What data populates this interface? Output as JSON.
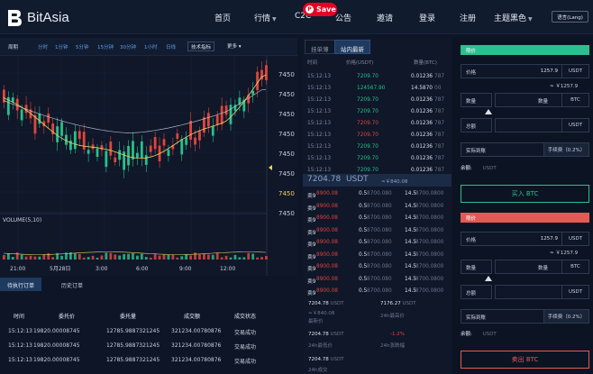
{
  "header": {
    "brand": "BitAsia",
    "nav": [
      "首页",
      "行情",
      "C2C",
      "公告",
      "邀请",
      "登录",
      "注册",
      "主题黑色"
    ],
    "save_label": "Save",
    "lang_label": "语言(Lang)"
  },
  "toolbar": {
    "items": [
      "周期",
      "分时",
      "1分钟",
      "5分钟",
      "15分钟",
      "30分钟",
      "1小时",
      "日线"
    ],
    "indicator_btn": "技术指标",
    "more_btn": "更多"
  },
  "chart": {
    "price_ticks": [
      "7450",
      "7450",
      "7450",
      "7450",
      "7450",
      "7450",
      "7450",
      "7450"
    ],
    "highlight_tick_index": 6,
    "volume_label": "VOLUME(5,10)",
    "time_labels": [
      "21:00",
      "5月28日",
      "3:00",
      "6:00",
      "9:00",
      "12:00"
    ],
    "colors": {
      "up": "#27c08b",
      "down": "#e0463c",
      "ma1": "#e6d36a",
      "ma2": "#cfd6e4"
    }
  },
  "orderbook": {
    "tabs": [
      "挂单薄",
      "站内最新"
    ],
    "active_tab": 1,
    "headers": [
      "时间",
      "价格(USDT)",
      "数量(BTC)"
    ],
    "trades": [
      {
        "time": "15:12:13",
        "price": "7209.70",
        "qty": "0.01236",
        "suffix": "787",
        "side": "buy"
      },
      {
        "time": "15:12:13",
        "price": "124567.90",
        "qty": "14.5870",
        "suffix": "00",
        "side": "buy"
      },
      {
        "time": "15:12:13",
        "price": "7209.70",
        "qty": "0.01236",
        "suffix": "787",
        "side": "buy"
      },
      {
        "time": "15:12:13",
        "price": "7209.70",
        "qty": "0.01236",
        "suffix": "787",
        "side": "buy"
      },
      {
        "time": "15:12:13",
        "price": "7209.70",
        "qty": "0.01236",
        "suffix": "787",
        "side": "sell"
      },
      {
        "time": "15:12:13",
        "price": "7209.70",
        "qty": "0.01236",
        "suffix": "787",
        "side": "sell"
      },
      {
        "time": "15:12:13",
        "price": "7209.70",
        "qty": "0.01236",
        "suffix": "787",
        "side": "buy"
      },
      {
        "time": "15:12:13",
        "price": "7209.70",
        "qty": "0.01236",
        "suffix": "787",
        "side": "buy"
      },
      {
        "time": "15:12:13",
        "price": "7209.70",
        "qty": "0.01236",
        "suffix": "787",
        "side": "buy"
      }
    ],
    "mid_price": "7204.78",
    "mid_unit": "USDT",
    "mid_cny": "≈￥840.08",
    "sell_rows": [
      {
        "label": "卖9",
        "price": "8900.08",
        "qty": "0.5",
        "qty_suffix": "8700.080",
        "total": "14.5",
        "total_suffix": "8700.0800"
      },
      {
        "label": "卖9",
        "price": "8900.08",
        "qty": "0.5",
        "qty_suffix": "8700.080",
        "total": "14.5",
        "total_suffix": "8700.0800"
      },
      {
        "label": "卖9",
        "price": "8900.08",
        "qty": "0.5",
        "qty_suffix": "8700.080",
        "total": "14.5",
        "total_suffix": "8700.0800"
      },
      {
        "label": "卖9",
        "price": "8900.08",
        "qty": "0.5",
        "qty_suffix": "8700.080",
        "total": "14.5",
        "total_suffix": "8700.0800"
      },
      {
        "label": "卖9",
        "price": "8900.08",
        "qty": "0.5",
        "qty_suffix": "8700.080",
        "total": "14.5",
        "total_suffix": "8700.0800"
      },
      {
        "label": "卖9",
        "price": "8900.08",
        "qty": "0.5",
        "qty_suffix": "8700.080",
        "total": "14.5",
        "total_suffix": "8700.0800"
      },
      {
        "label": "卖9",
        "price": "8900.08",
        "qty": "0.5",
        "qty_suffix": "8700.080",
        "total": "14.5",
        "total_suffix": "8700.0800"
      },
      {
        "label": "卖9",
        "price": "8900.08",
        "qty": "0.5",
        "qty_suffix": "8700.080",
        "total": "14.5",
        "total_suffix": "8700.0800"
      },
      {
        "label": "卖9",
        "price": "8900.08",
        "qty": "0.5",
        "qty_suffix": "8700.080",
        "total": "14.5",
        "total_suffix": "8700.0800"
      }
    ],
    "stats": {
      "last_price": "7204.78",
      "last_unit": "USDT",
      "last_cny": "≈￥840.08",
      "last_label": "最新价",
      "high_24": "7176.27",
      "high_unit": "USDT",
      "high_label": "24h最高价",
      "low_24": "7204.78",
      "low_unit": "USDT",
      "low_label": "24h最低价",
      "change_24": "-1.2%",
      "change_label": "24h涨跌幅",
      "vol_24": "7204.78",
      "vol_unit": "USDT",
      "vol_label": "24h成交"
    }
  },
  "buy_form": {
    "tag": "限价",
    "price_label": "价格",
    "price_value": "1257.9",
    "price_unit": "USDT",
    "approx": "≈ ￥1257.9",
    "qty_label": "数量",
    "qty_placeholder": "数量",
    "qty_unit": "BTC",
    "total_label": "总额",
    "total_unit": "USDT",
    "fee_prefix": "实际到账",
    "fee": "手续费（0.2%）",
    "balance_label": "余额:",
    "balance_unit": "USDT",
    "button": "买入 BTC"
  },
  "sell_form": {
    "tag": "限价",
    "price_label": "价格",
    "price_value": "1257.9",
    "price_unit": "USDT",
    "approx": "≈ ￥1257.9",
    "qty_label": "数量",
    "qty_placeholder": "数量",
    "qty_unit": "BTC",
    "total_label": "总额",
    "total_unit": "USDT",
    "fee_prefix": "实际到账",
    "fee": "手续费（0.2%）",
    "balance_label": "余额:",
    "balance_unit": "USDT",
    "button": "卖出 BTC"
  },
  "orders": {
    "tabs": [
      "待执行订单",
      "历史订单"
    ],
    "headers": [
      "时间",
      "委托价",
      "委托量",
      "成交额",
      "成交状态"
    ],
    "rows": [
      [
        "15:12:13",
        "19820.00008745",
        "12785.9887321245",
        "321234.00780876",
        "交易成功"
      ],
      [
        "15:12:13",
        "19820.00008745",
        "12785.9887321245",
        "321234.00780876",
        "交易成功"
      ],
      [
        "15:12:13",
        "19820.00008745",
        "12785.9887321245",
        "321234.00780876",
        "交易成功"
      ]
    ]
  }
}
